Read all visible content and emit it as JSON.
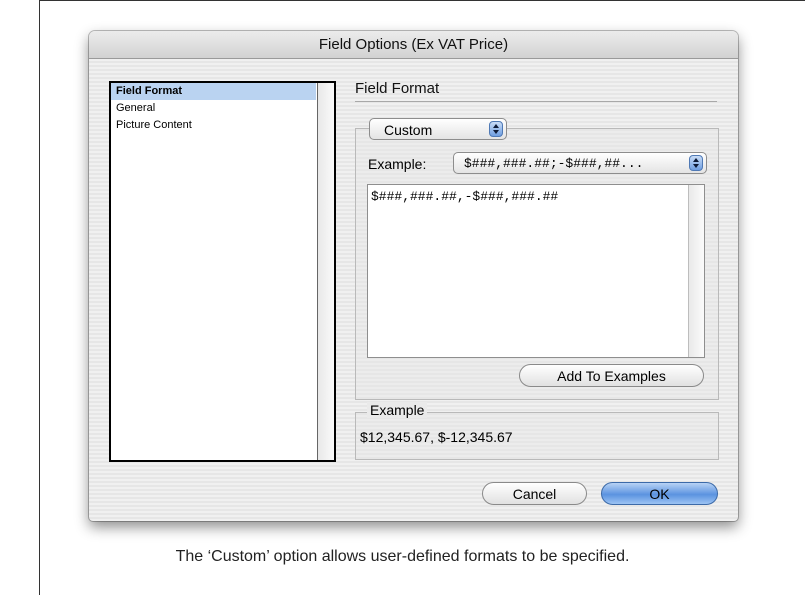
{
  "dialog": {
    "title": "Field Options (Ex VAT Price)",
    "categories": [
      {
        "label": "Field Format",
        "selected": true
      },
      {
        "label": "General",
        "selected": false
      },
      {
        "label": "Picture Content",
        "selected": false
      }
    ],
    "section_title": "Field Format",
    "format_type": "Custom",
    "example_label": "Example:",
    "example_selected": "$###,###.##;-$###,##...",
    "format_text": "$###,###.##,-$###,###.##",
    "add_button": "Add To Examples",
    "preview_legend": "Example",
    "preview_value": "$12,345.67, $-12,345.67",
    "cancel_button": "Cancel",
    "ok_button": "OK"
  },
  "caption": "The ‘Custom’ option allows user-defined formats to be specified."
}
